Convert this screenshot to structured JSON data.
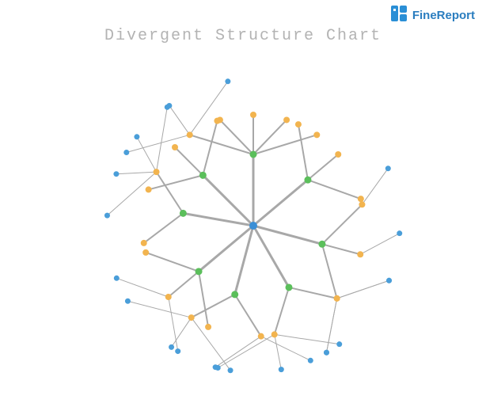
{
  "brand": {
    "name": "FineReport"
  },
  "title": "Divergent Structure Chart",
  "colors": {
    "root": "#3b8fd6",
    "level1": "#5bbf5b",
    "level2": "#f2b44f",
    "level3": "#4a9ed9",
    "edge": "#a8a8a8"
  },
  "chart_data": {
    "type": "tree",
    "title": "Divergent Structure Chart",
    "layout": "radial",
    "levels": 4,
    "node_counts_by_level": [
      1,
      8,
      24,
      24
    ],
    "color_by_level": [
      "blue",
      "green",
      "orange",
      "blue"
    ],
    "root": {
      "id": "R",
      "level": 0,
      "children": [
        {
          "id": "A",
          "level": 1,
          "angle_deg": 270,
          "children": [
            {
              "id": "A1",
              "level": 2,
              "children": [
                {
                  "id": "A1a",
                  "level": 3
                },
                {
                  "id": "A1b",
                  "level": 3
                },
                {
                  "id": "A1c",
                  "level": 3
                }
              ]
            },
            {
              "id": "A2",
              "level": 2,
              "children": []
            },
            {
              "id": "A3",
              "level": 2,
              "children": []
            },
            {
              "id": "A4",
              "level": 2,
              "children": []
            },
            {
              "id": "A5",
              "level": 2,
              "children": []
            }
          ]
        },
        {
          "id": "B",
          "level": 1,
          "angle_deg": 320,
          "children": [
            {
              "id": "B1",
              "level": 2,
              "children": []
            },
            {
              "id": "B2",
              "level": 2,
              "children": []
            },
            {
              "id": "B3",
              "level": 2,
              "children": []
            }
          ]
        },
        {
          "id": "C",
          "level": 1,
          "angle_deg": 15,
          "children": [
            {
              "id": "C1",
              "level": 2,
              "children": [
                {
                  "id": "C1a",
                  "level": 3
                }
              ]
            },
            {
              "id": "C2",
              "level": 2,
              "children": [
                {
                  "id": "C2a",
                  "level": 3
                }
              ]
            },
            {
              "id": "C3",
              "level": 2,
              "children": [
                {
                  "id": "C3a",
                  "level": 3
                },
                {
                  "id": "C3b",
                  "level": 3
                }
              ]
            }
          ]
        },
        {
          "id": "D",
          "level": 1,
          "angle_deg": 60,
          "children": [
            {
              "id": "D1",
              "level": 2,
              "children": [
                {
                  "id": "D1a",
                  "level": 3
                },
                {
                  "id": "D1b",
                  "level": 3
                }
              ]
            },
            {
              "id": "D2",
              "level": 2,
              "children": [
                {
                  "id": "D2a",
                  "level": 3
                },
                {
                  "id": "D2b",
                  "level": 3
                },
                {
                  "id": "D2c",
                  "level": 3
                }
              ]
            }
          ]
        },
        {
          "id": "E",
          "level": 1,
          "angle_deg": 105,
          "children": [
            {
              "id": "E1",
              "level": 2,
              "children": [
                {
                  "id": "E1a",
                  "level": 3
                },
                {
                  "id": "E1b",
                  "level": 3
                }
              ]
            },
            {
              "id": "E2",
              "level": 2,
              "children": [
                {
                  "id": "E2a",
                  "level": 3
                },
                {
                  "id": "E2b",
                  "level": 3
                },
                {
                  "id": "E2c",
                  "level": 3
                }
              ]
            }
          ]
        },
        {
          "id": "F",
          "level": 1,
          "angle_deg": 140,
          "children": [
            {
              "id": "F1",
              "level": 2,
              "children": []
            },
            {
              "id": "F2",
              "level": 2,
              "children": [
                {
                  "id": "F2a",
                  "level": 3
                },
                {
                  "id": "F2b",
                  "level": 3
                }
              ]
            },
            {
              "id": "F3",
              "level": 2,
              "children": []
            }
          ]
        },
        {
          "id": "G",
          "level": 1,
          "angle_deg": 190,
          "children": [
            {
              "id": "G1",
              "level": 2,
              "children": []
            },
            {
              "id": "G2",
              "level": 2,
              "children": [
                {
                  "id": "G2a",
                  "level": 3
                },
                {
                  "id": "G2b",
                  "level": 3
                },
                {
                  "id": "G2c",
                  "level": 3
                },
                {
                  "id": "G2d",
                  "level": 3
                }
              ]
            }
          ]
        },
        {
          "id": "H",
          "level": 1,
          "angle_deg": 225,
          "children": [
            {
              "id": "H1",
              "level": 2,
              "children": []
            },
            {
              "id": "H2",
              "level": 2,
              "children": []
            },
            {
              "id": "H3",
              "level": 2,
              "children": []
            }
          ]
        }
      ]
    }
  }
}
